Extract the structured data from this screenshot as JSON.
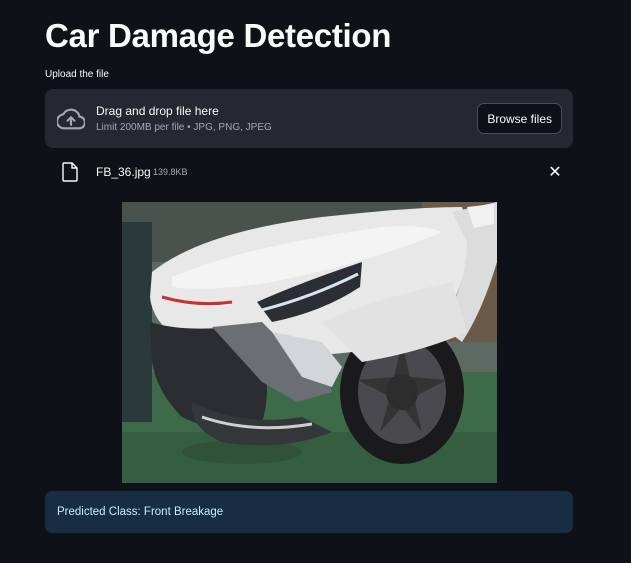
{
  "app": {
    "title": "Car Damage Detection"
  },
  "uploader": {
    "label": "Upload the file",
    "drop_text": "Drag and drop file here",
    "limit_text": "Limit 200MB per file • JPG, PNG, JPEG",
    "browse_label": "Browse files",
    "upload_icon": "cloud-upload-icon"
  },
  "uploaded_file": {
    "name": "FB_36.jpg",
    "size": "139.8KB",
    "file_icon": "file-icon",
    "remove_icon": "close-icon",
    "remove_symbol": "✕"
  },
  "image": {
    "subject": "damaged white car front"
  },
  "result": {
    "text": "Predicted Class: Front Breakage"
  },
  "colors": {
    "background": "#0e1117",
    "dropzone": "#262730",
    "result_bg": "#172d43",
    "result_text": "#c7ebff"
  }
}
